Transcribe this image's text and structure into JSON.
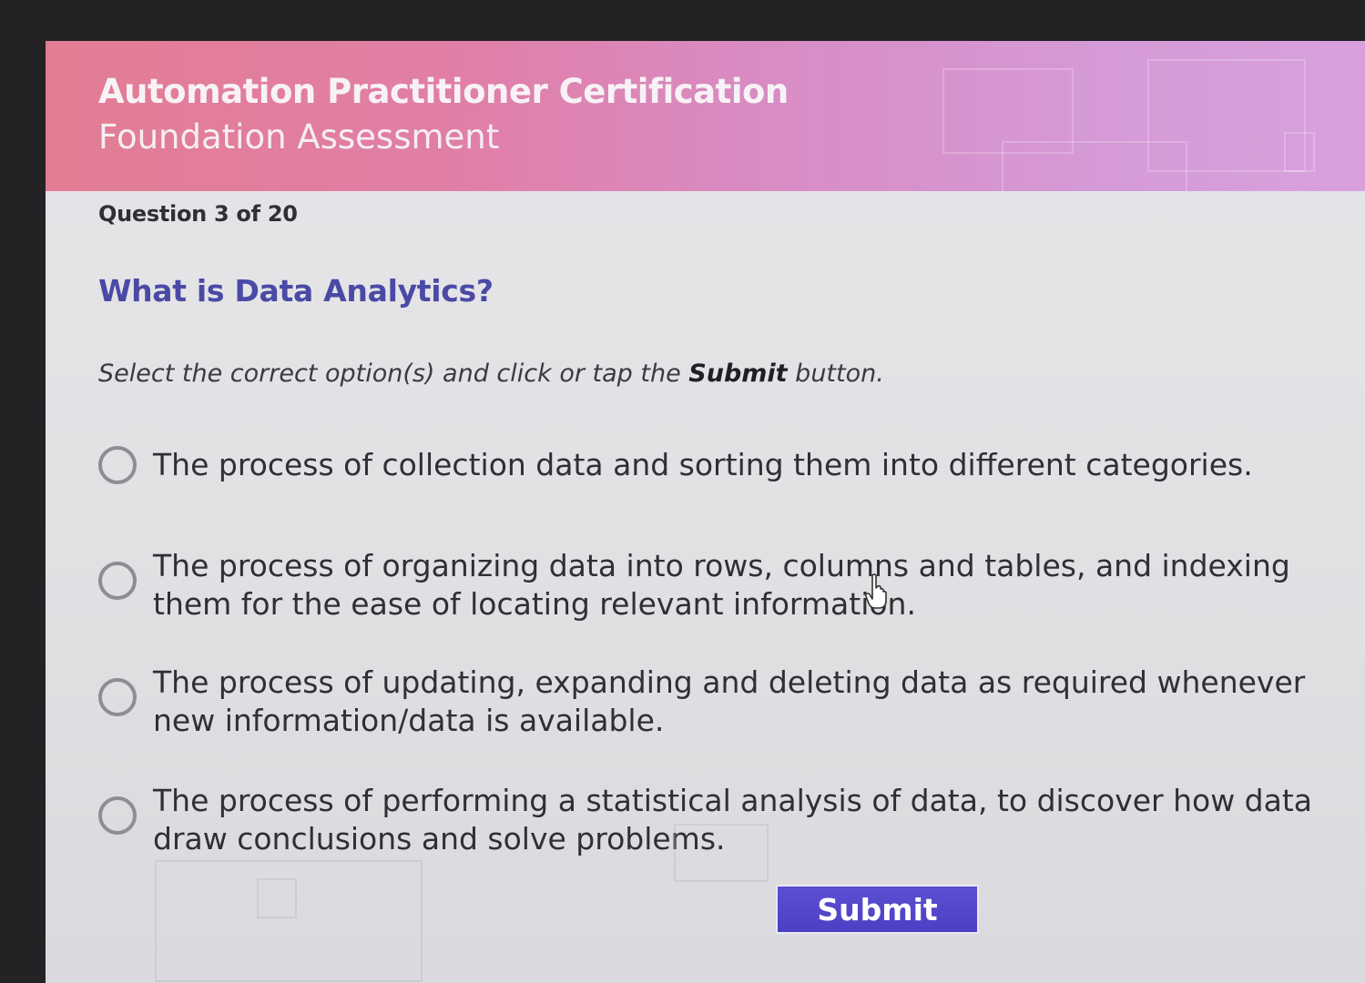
{
  "header": {
    "title": "Automation Practitioner Certification",
    "subtitle": "Foundation Assessment"
  },
  "progress": {
    "label": "Question 3 of 20",
    "current": 3,
    "total": 20
  },
  "question": {
    "text": "What is Data Analytics?"
  },
  "instruction": {
    "prefix": "Select the correct option(s) and click or tap the ",
    "emphasis": "Submit",
    "suffix": " button."
  },
  "options": [
    {
      "text": "The process of collection data and sorting them into different categories.",
      "selected": false
    },
    {
      "text": "The process of organizing data into rows, columns and tables, and indexing\nthem for the ease of locating relevant information.",
      "selected": false
    },
    {
      "text": "The process of updating, expanding and deleting data as required whenever\nnew information/data is available.",
      "selected": false
    },
    {
      "text": "The process of performing a statistical analysis of data, to discover how data\ndraw conclusions and solve problems.",
      "selected": false
    }
  ],
  "submit": {
    "label": "Submit"
  },
  "icons": {
    "radio": "radio-unselected-icon",
    "cursor": "hand-pointer-icon"
  },
  "colors": {
    "banner_start": "#e27d93",
    "banner_end": "#d8a1dd",
    "question_text": "#4a4aa6",
    "submit_bg": "#4b40c4"
  }
}
